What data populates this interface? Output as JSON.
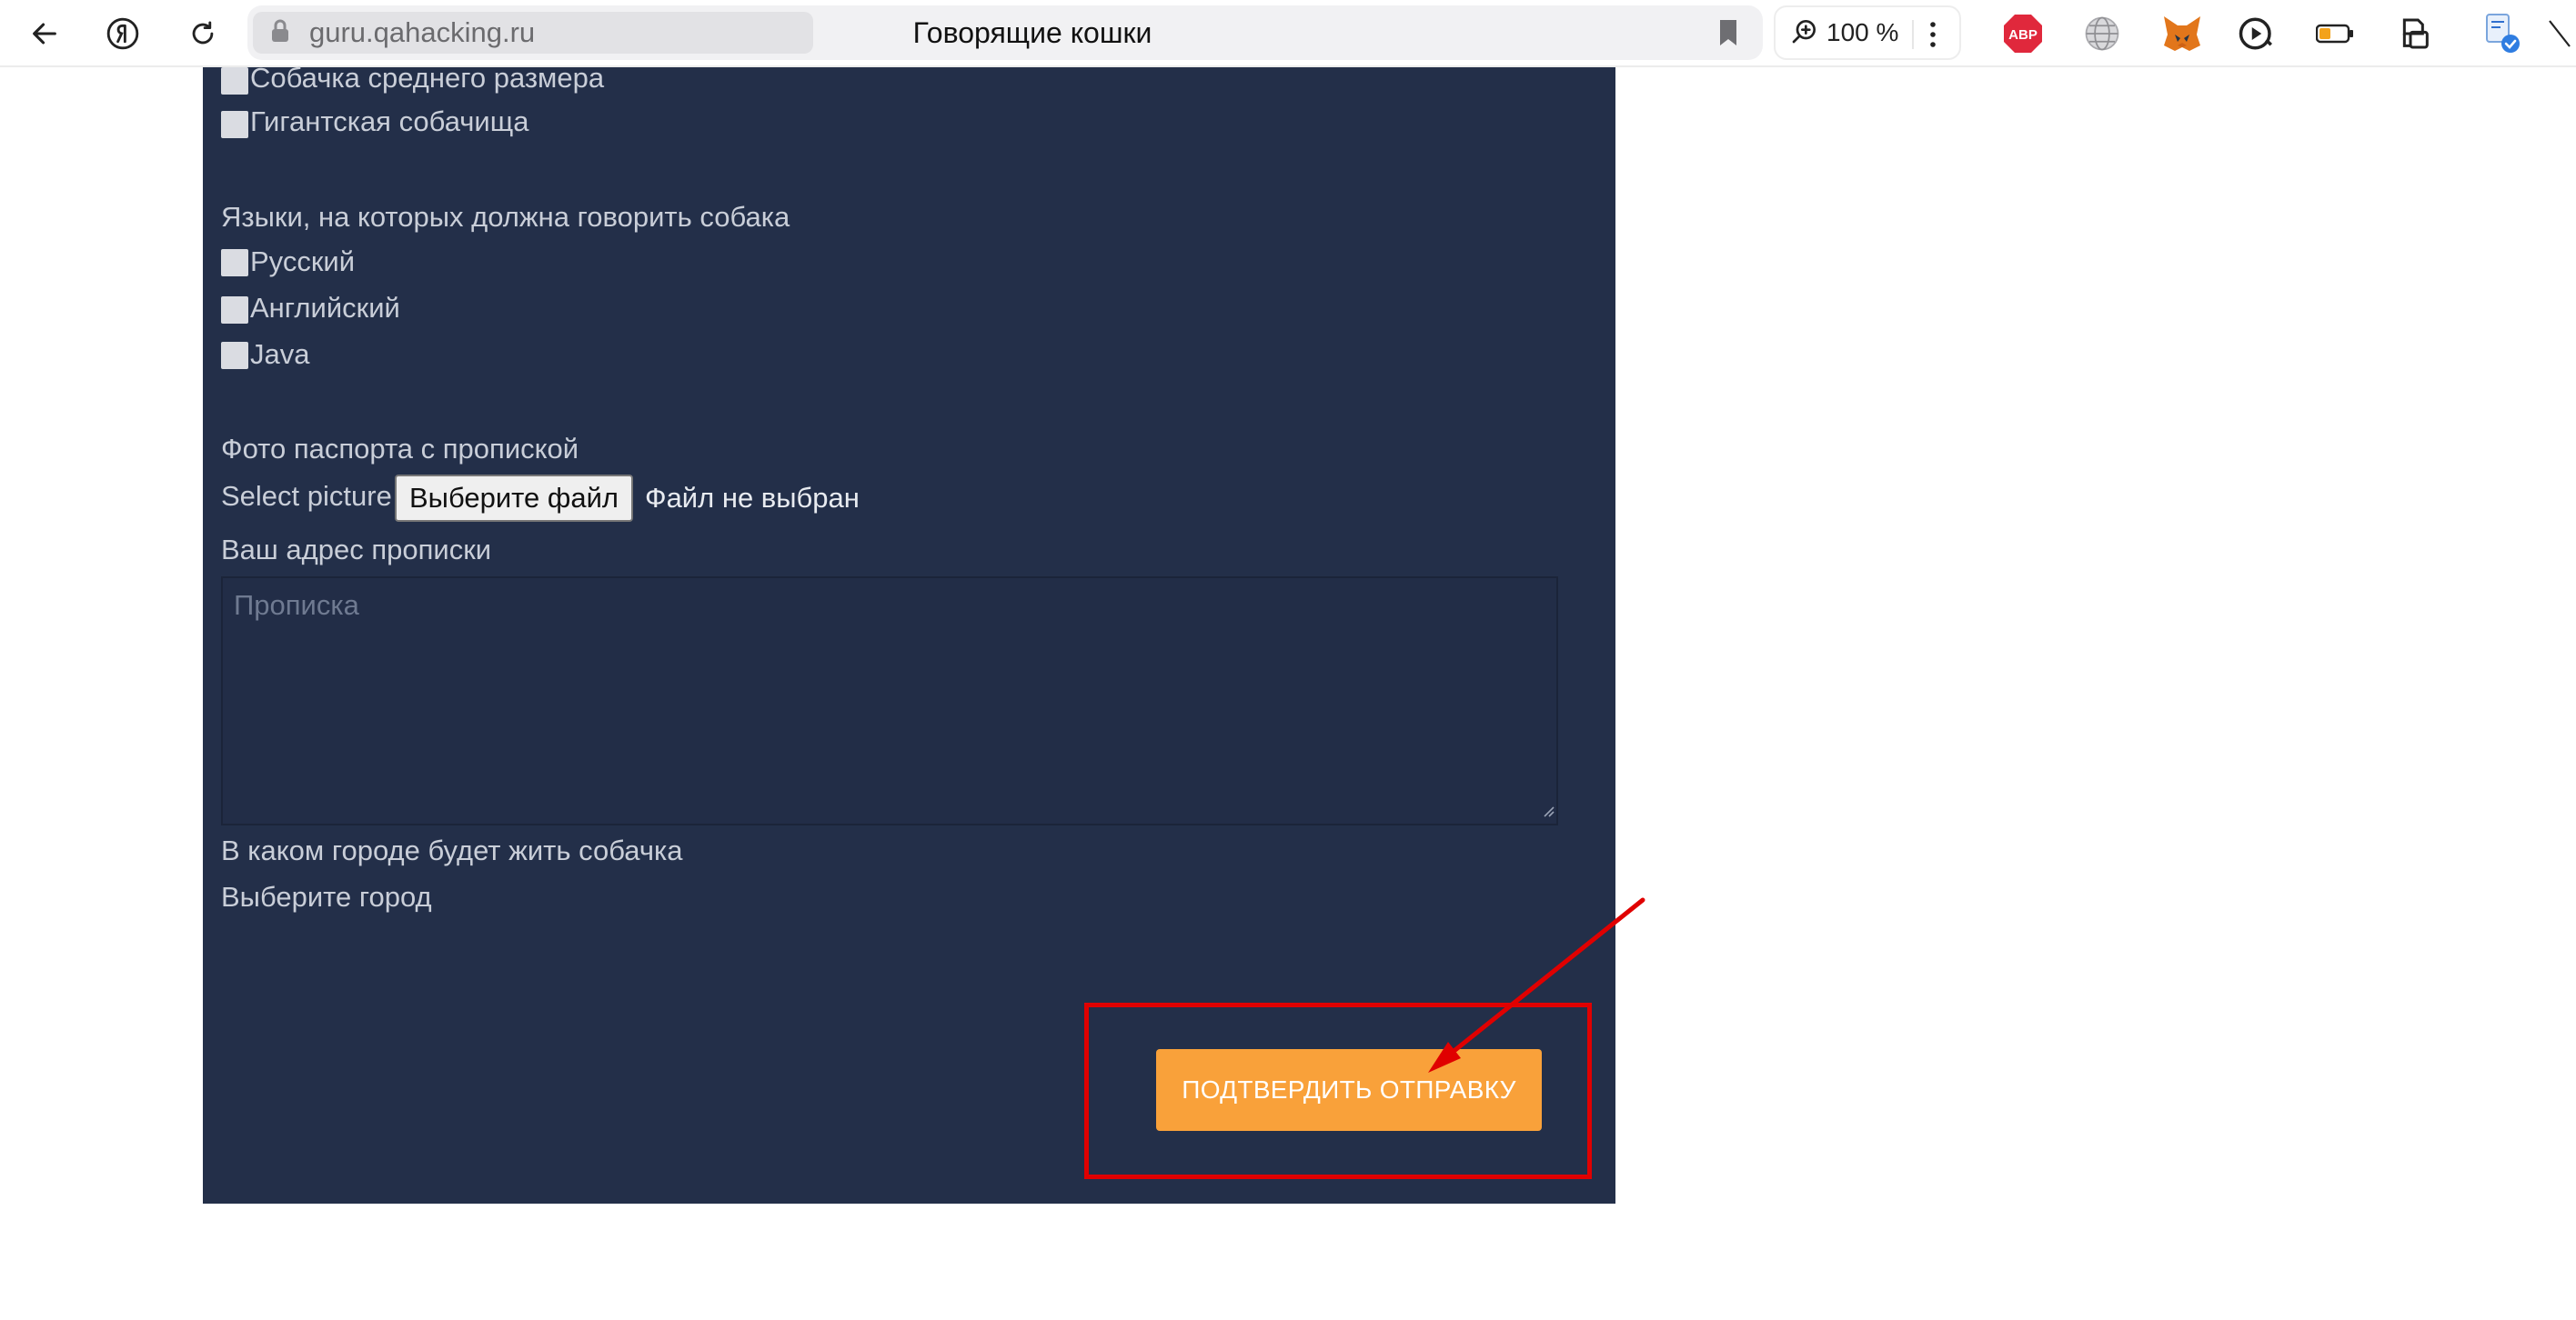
{
  "browser": {
    "domain": "guru.qahacking.ru",
    "tab_title": "Говорящие кошки",
    "zoom": "100 %",
    "extensions": [
      "abp-icon",
      "globe-icon",
      "metamask-fox-icon",
      "media-player-icon",
      "battery-icon",
      "collections-icon",
      "translate-icon"
    ],
    "extension_abp_label": "ABP"
  },
  "form": {
    "size_options": [
      "Собачка среднего размера",
      "Гигантская собачища"
    ],
    "languages_heading": "Языки, на которых должна говорить собака",
    "language_options": [
      "Русский",
      "Английский",
      "Java"
    ],
    "passport_heading": "Фото паспорта с пропиской",
    "select_picture_label": "Select picture",
    "file_button": "Выберите файл",
    "file_status": "Файл не выбран",
    "address_heading": "Ваш адрес прописки",
    "address_placeholder": "Прописка",
    "city_heading": "В каком городе будет жить собачка",
    "city_select_label": "Выберите город",
    "submit_button": "ПОДТВЕРДИТЬ ОТПРАВКУ"
  },
  "annotation": {
    "color": "#e00000"
  },
  "colors": {
    "panel_bg": "#232f49",
    "submit_bg": "#f9a13a",
    "text": "#c9ced8"
  }
}
